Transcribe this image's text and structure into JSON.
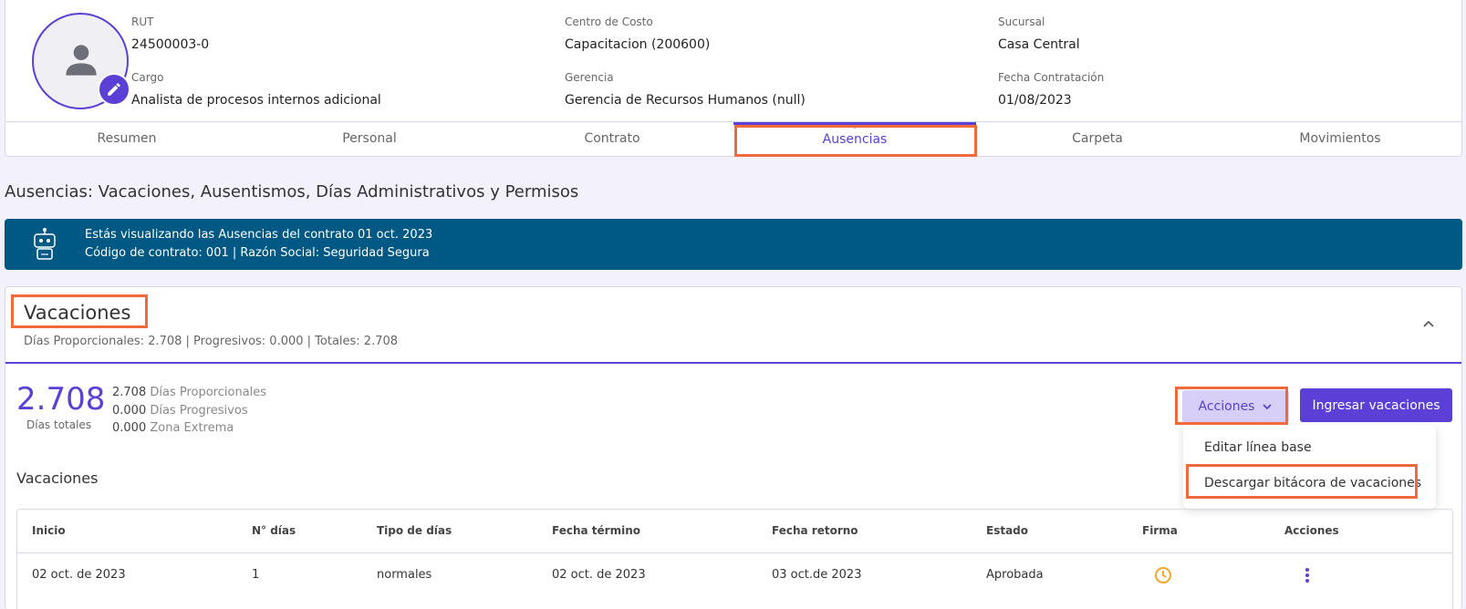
{
  "employee": {
    "rut_label": "RUT",
    "rut": "24500003-0",
    "centro_label": "Centro de Costo",
    "centro": "Capacitacion (200600)",
    "sucursal_label": "Sucursal",
    "sucursal": "Casa Central",
    "cargo_label": "Cargo",
    "cargo": "Analista de procesos internos adicional",
    "gerencia_label": "Gerencia",
    "gerencia": "Gerencia de Recursos Humanos (null)",
    "fecha_label": "Fecha Contratación",
    "fecha": "01/08/2023"
  },
  "tabs": [
    {
      "label": "Resumen"
    },
    {
      "label": "Personal"
    },
    {
      "label": "Contrato"
    },
    {
      "label": "Ausencias"
    },
    {
      "label": "Carpeta"
    },
    {
      "label": "Movimientos"
    }
  ],
  "active_tab": "Ausencias",
  "section_title": "Ausencias: Vacaciones, Ausentismos, Días Administrativos y Permisos",
  "banner": {
    "line1": "Estás visualizando las Ausencias del contrato 01 oct. 2023",
    "line2": "Código de contrato: 001 | Razón Social: Seguridad Segura"
  },
  "vacaciones": {
    "title": "Vacaciones",
    "subtitle": "Días Proporcionales: 2.708 | Progresivos: 0.000 | Totales: 2.708",
    "total": "2.708",
    "total_label": "Días totales",
    "breakdown": [
      {
        "value": "2.708",
        "label": "Días Proporcionales"
      },
      {
        "value": "0.000",
        "label": "Días Progresivos"
      },
      {
        "value": "0.000",
        "label": "Zona Extrema"
      }
    ],
    "acciones_label": "Acciones",
    "ingresar_label": "Ingresar vacaciones",
    "dropdown": [
      "Editar línea base",
      "Descargar bitácora de vacaciones"
    ],
    "list_title": "Vacaciones"
  },
  "table": {
    "headers": [
      "Inicio",
      "N° días",
      "Tipo de días",
      "Fecha término",
      "Fecha retorno",
      "Estado",
      "Firma",
      "Acciones"
    ],
    "rows": [
      {
        "inicio": "02 oct. de 2023",
        "dias": "1",
        "tipo": "normales",
        "termino": "02 oct. de 2023",
        "retorno": "03 oct.de 2023",
        "estado": "Aprobada",
        "firma_icon": "clock-icon",
        "acciones_icon": "kebab-icon"
      }
    ]
  },
  "colors": {
    "accent": "#5b3fd6",
    "banner": "#005884",
    "highlight": "#f26a3c",
    "pending": "#f5a623"
  }
}
